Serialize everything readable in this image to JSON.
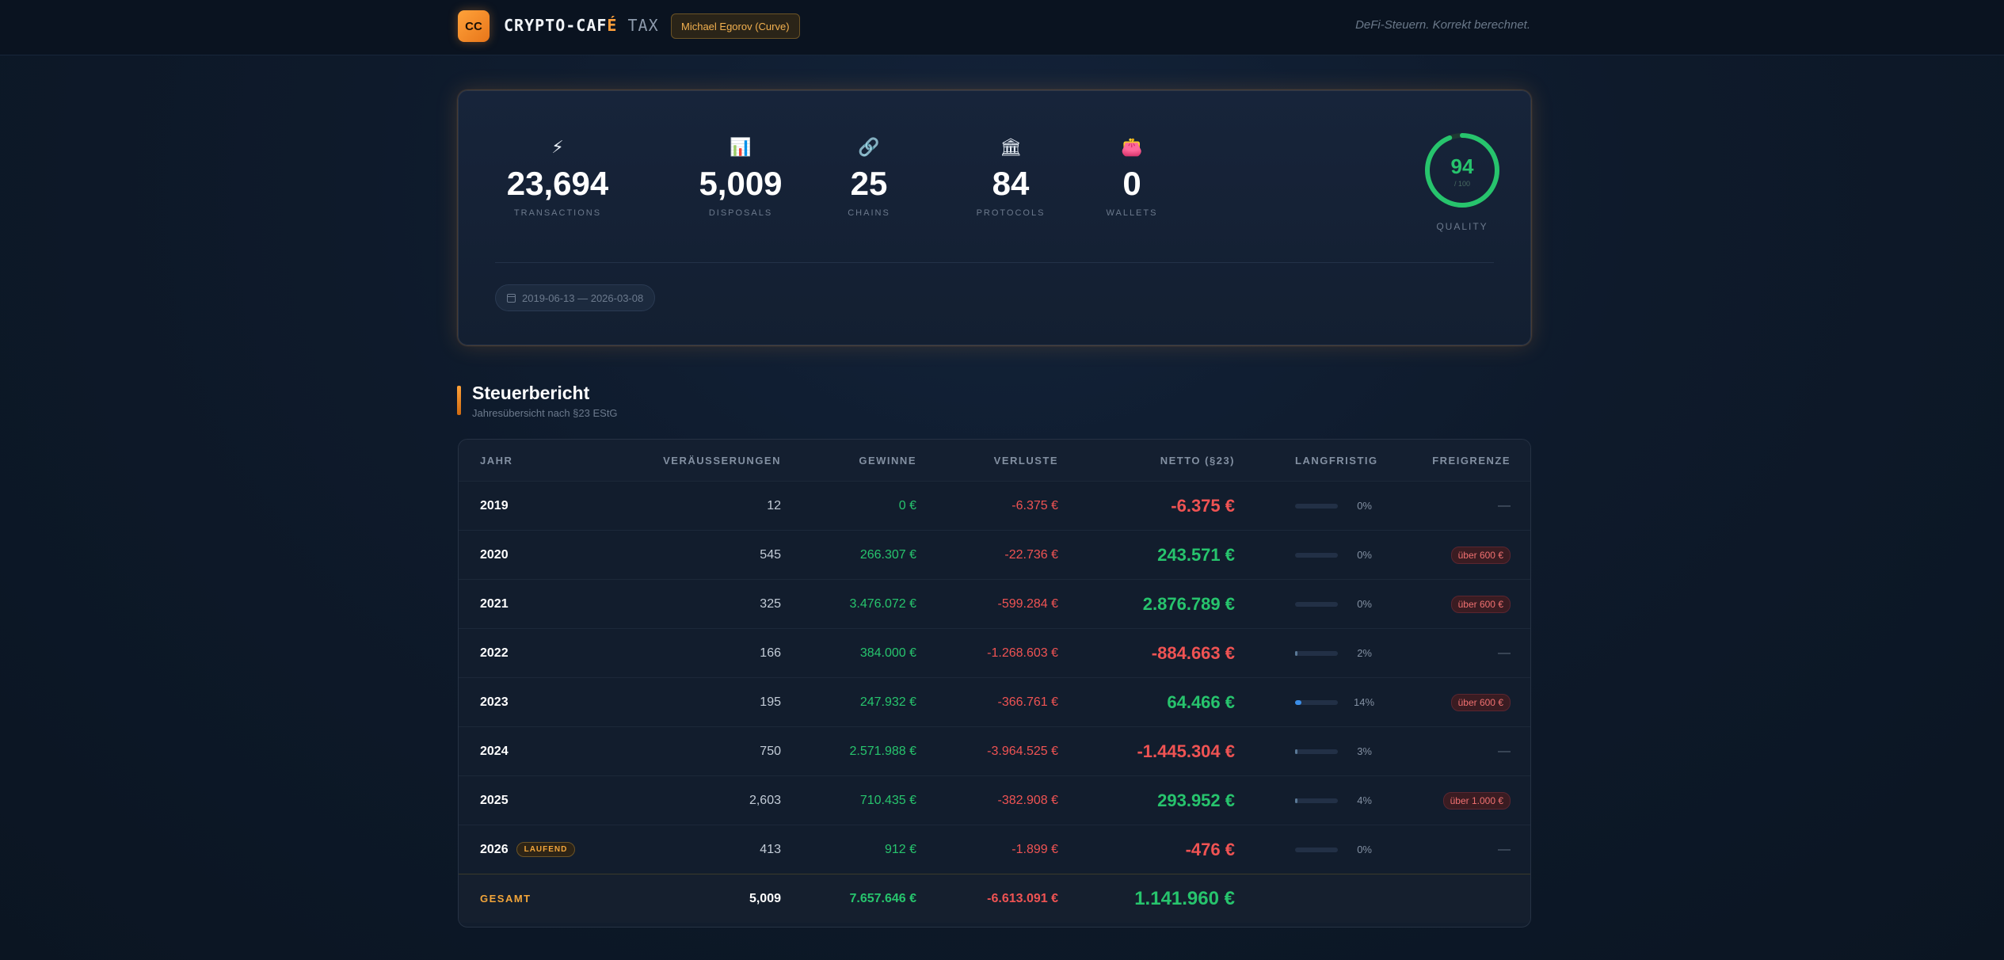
{
  "header": {
    "logo_text": "CC",
    "brand_main": "CRYPTO-CAF",
    "brand_accent": "É",
    "brand_suffix": " TAX",
    "user": "Michael Egorov (Curve)",
    "tagline": "DeFi-Steuern. Korrekt berechnet."
  },
  "stats": {
    "items": [
      {
        "icon": "⚡",
        "icon_name": "lightning-icon",
        "value": "23,694",
        "label": "TRANSACTIONS"
      },
      {
        "icon": "📊",
        "icon_name": "bar-chart-icon",
        "value": "5,009",
        "label": "DISPOSALS"
      },
      {
        "icon": "🔗",
        "icon_name": "link-icon",
        "value": "25",
        "label": "CHAINS"
      },
      {
        "icon": "🏛",
        "icon_name": "bank-icon",
        "value": "84",
        "label": "PROTOCOLS"
      },
      {
        "icon": "👛",
        "icon_name": "purse-icon",
        "value": "0",
        "label": "WALLETS"
      }
    ],
    "quality": {
      "score": "94",
      "max": "/ 100",
      "label": "QUALITY",
      "fraction": 0.94,
      "color": "#27c46d"
    },
    "date_range": "2019-06-13 — 2026-03-08"
  },
  "section": {
    "title": "Steuerbericht",
    "subtitle": "Jahresübersicht nach §23 EStG"
  },
  "table": {
    "headers": {
      "year": "JAHR",
      "disposals": "VERÄUSSERUNGEN",
      "gains": "GEWINNE",
      "losses": "VERLUSTE",
      "net": "NETTO (§23)",
      "longterm": "LANGFRISTIG",
      "allowance": "FREIGRENZE"
    },
    "rows": [
      {
        "year": "2019",
        "badge": "",
        "disposals": "12",
        "gains": "0 €",
        "losses": "-6.375 €",
        "net": "-6.375 €",
        "net_sign": "neg",
        "longterm_pct": "0%",
        "longterm_fraction": 0.0,
        "allowance": "—"
      },
      {
        "year": "2020",
        "badge": "",
        "disposals": "545",
        "gains": "266.307 €",
        "losses": "-22.736 €",
        "net": "243.571 €",
        "net_sign": "pos",
        "longterm_pct": "0%",
        "longterm_fraction": 0.0,
        "allowance": "über 600 €"
      },
      {
        "year": "2021",
        "badge": "",
        "disposals": "325",
        "gains": "3.476.072 €",
        "losses": "-599.284 €",
        "net": "2.876.789 €",
        "net_sign": "pos",
        "longterm_pct": "0%",
        "longterm_fraction": 0.0,
        "allowance": "über 600 €"
      },
      {
        "year": "2022",
        "badge": "",
        "disposals": "166",
        "gains": "384.000 €",
        "losses": "-1.268.603 €",
        "net": "-884.663 €",
        "net_sign": "neg",
        "longterm_pct": "2%",
        "longterm_fraction": 0.02,
        "allowance": "—"
      },
      {
        "year": "2023",
        "badge": "",
        "disposals": "195",
        "gains": "247.932 €",
        "losses": "-366.761 €",
        "net": "64.466 €",
        "net_sign": "pos",
        "longterm_pct": "14%",
        "longterm_fraction": 0.14,
        "allowance": "über 600 €"
      },
      {
        "year": "2024",
        "badge": "",
        "disposals": "750",
        "gains": "2.571.988 €",
        "losses": "-3.964.525 €",
        "net": "-1.445.304 €",
        "net_sign": "neg",
        "longterm_pct": "3%",
        "longterm_fraction": 0.03,
        "allowance": "—"
      },
      {
        "year": "2025",
        "badge": "",
        "disposals": "2,603",
        "gains": "710.435 €",
        "losses": "-382.908 €",
        "net": "293.952 €",
        "net_sign": "pos",
        "longterm_pct": "4%",
        "longterm_fraction": 0.04,
        "allowance": "über 1.000 €"
      },
      {
        "year": "2026",
        "badge": "LAUFEND",
        "disposals": "413",
        "gains": "912 €",
        "losses": "-1.899 €",
        "net": "-476 €",
        "net_sign": "neg",
        "longterm_pct": "0%",
        "longterm_fraction": 0.0,
        "allowance": "—"
      }
    ],
    "total": {
      "label": "GESAMT",
      "disposals": "5,009",
      "gains": "7.657.646 €",
      "losses": "-6.613.091 €",
      "net": "1.141.960 €",
      "net_sign": "pos"
    }
  },
  "colors": {
    "accent": "#ff9f3a",
    "positive": "#27c46d",
    "negative": "#ef5353",
    "bar": "#3b8ee8"
  }
}
